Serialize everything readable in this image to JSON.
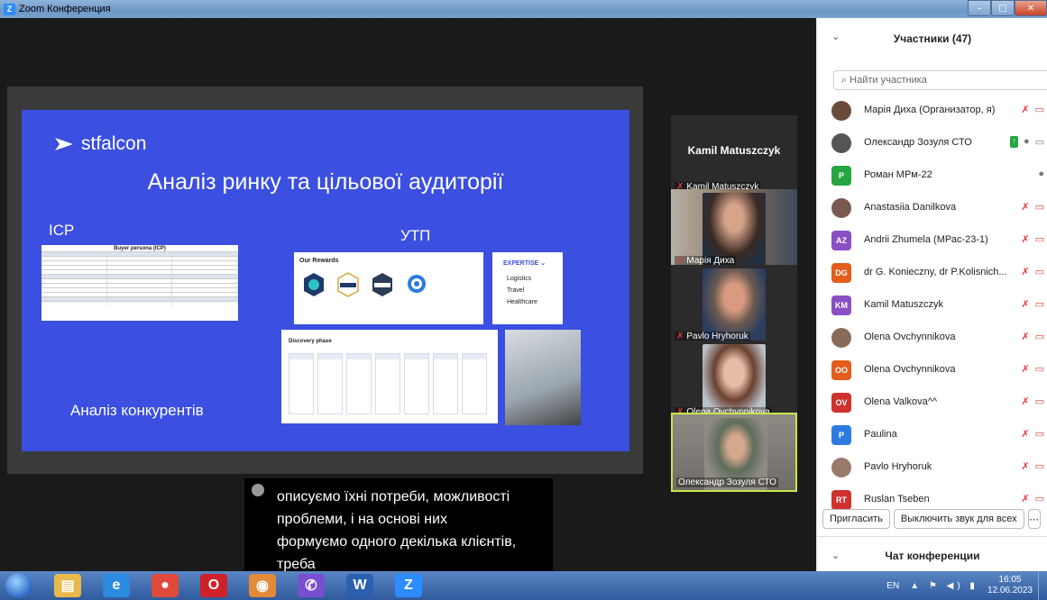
{
  "window": {
    "title": "Zoom Конференция",
    "min": "–",
    "max": "□",
    "close": "✕"
  },
  "slide": {
    "brand": "stfalcon",
    "heading": "Аналіз ринку та цільової аудиторії",
    "icp_label": "ICP",
    "utp_label": "УТП",
    "competitors_label": "Аналіз конкурентів",
    "persona_title": "Buyer persona (ICP)",
    "rewards_title": "Our Rewards",
    "expertise_title": "EXPERTISE ⌄",
    "expertise_items": [
      "Logistics",
      "Travel",
      "Healthcare"
    ],
    "discovery_title": "Discovery phase"
  },
  "gallery": {
    "spotlight_name": "Kamil Matuszczyk",
    "tiles": [
      {
        "name": "Kamil Matuszczyk",
        "muted": true
      },
      {
        "name": "Марія Диха",
        "muted": true
      },
      {
        "name": "Pavlo Hryhoruk",
        "muted": true
      },
      {
        "name": "Olena Ovchynnikova",
        "muted": true
      },
      {
        "name": "Олександр Зозуля СТО",
        "muted": false
      }
    ]
  },
  "caption": {
    "lines": [
      "описуємо їхні потреби, можливості",
      "проблеми, і на основі них",
      "формуємо одного декілька клієнтів,",
      "треба"
    ]
  },
  "panel": {
    "title": "Участники (47)",
    "search_placeholder": "Найти участника",
    "participants": [
      {
        "name": "Марія Диха (Организатор, я)",
        "avatar": "photo",
        "initials": "",
        "color": "#6a4a3a",
        "icons": "muted-camoff"
      },
      {
        "name": "Олександр Зозуля СТО",
        "avatar": "photo",
        "initials": "",
        "color": "#555555",
        "icons": "share-mic-cam"
      },
      {
        "name": "Роман МРм-22",
        "avatar": "initials",
        "initials": "P",
        "color": "#26a541",
        "icons": "mic"
      },
      {
        "name": "Anastasiia Danilkova",
        "avatar": "photo",
        "initials": "",
        "color": "#7a5a50",
        "icons": "muted-camoff"
      },
      {
        "name": "Andrii Zhumela (МРас-23-1)",
        "avatar": "initials",
        "initials": "AZ",
        "color": "#8a4fc4",
        "icons": "muted-camoff"
      },
      {
        "name": "dr G. Konieczny, dr P.Kolisnich...",
        "avatar": "initials",
        "initials": "DG",
        "color": "#e35d1c",
        "icons": "muted-camoff"
      },
      {
        "name": "Kamil Matuszczyk",
        "avatar": "initials",
        "initials": "KM",
        "color": "#8a4fc4",
        "icons": "muted-camoff"
      },
      {
        "name": "Olena Ovchynnikova",
        "avatar": "photo",
        "initials": "",
        "color": "#8a6a5a",
        "icons": "muted-camoff"
      },
      {
        "name": "Olena Ovchynnikova",
        "avatar": "initials",
        "initials": "OO",
        "color": "#e35d1c",
        "icons": "muted-camoff"
      },
      {
        "name": "Olena Valkova^^",
        "avatar": "initials",
        "initials": "OV",
        "color": "#d0312d",
        "icons": "muted-camoff"
      },
      {
        "name": "Paulina",
        "avatar": "initials",
        "initials": "P",
        "color": "#2d7be0",
        "icons": "muted-camoff"
      },
      {
        "name": "Pavlo Hryhoruk",
        "avatar": "photo",
        "initials": "",
        "color": "#9a7a6a",
        "icons": "muted-camoff"
      },
      {
        "name": "Ruslan Tseben",
        "avatar": "initials",
        "initials": "RT",
        "color": "#d0312d",
        "icons": "muted-camoff"
      }
    ],
    "invite_label": "Пригласить",
    "mute_all_label": "Выключить звук для всех",
    "chat_title": "Чат конференции"
  },
  "taskbar": {
    "lang": "EN",
    "time": "16:05",
    "date": "12.06.2023",
    "apps": [
      {
        "name": "explorer",
        "glyph": "▤",
        "color": "#e8b84a"
      },
      {
        "name": "ie",
        "glyph": "e",
        "color": "#2c8ae0"
      },
      {
        "name": "chrome",
        "glyph": "●",
        "color": "#e04a3a"
      },
      {
        "name": "opera",
        "glyph": "O",
        "color": "#d0202a"
      },
      {
        "name": "app",
        "glyph": "◉",
        "color": "#e08a3a"
      },
      {
        "name": "viber",
        "glyph": "✆",
        "color": "#7a4fcf"
      },
      {
        "name": "word",
        "glyph": "W",
        "color": "#2b5fb0"
      },
      {
        "name": "zoom",
        "glyph": "Z",
        "color": "#2d8cff"
      }
    ]
  },
  "colors": {
    "slide_bg": "#3b4fe0",
    "mute_red": "#e23d3d",
    "active_border": "#c8e64a"
  }
}
